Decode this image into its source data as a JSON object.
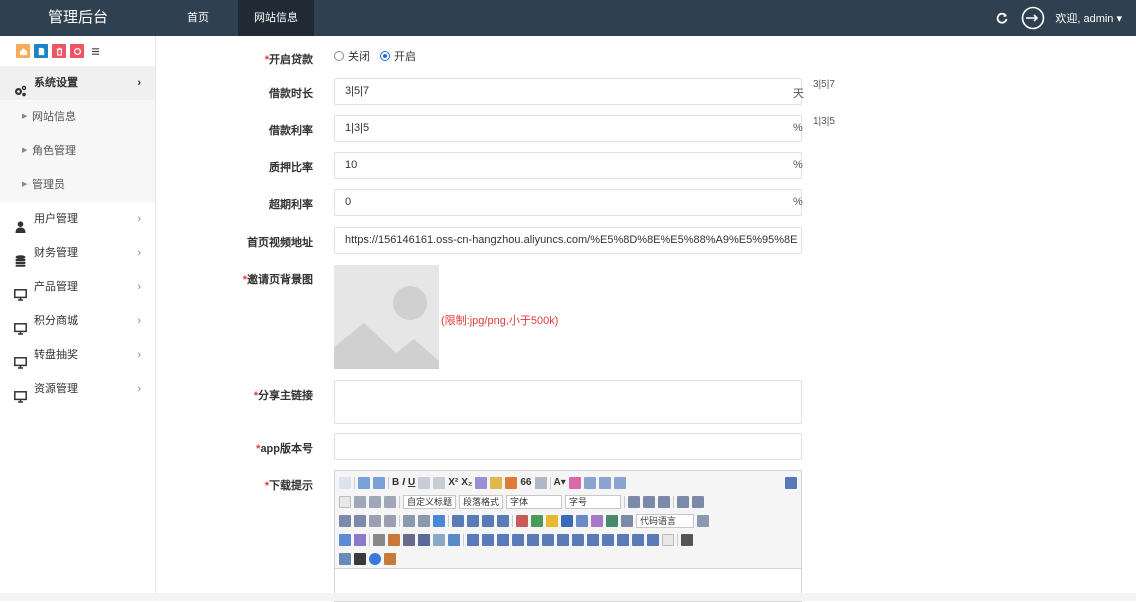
{
  "header": {
    "brand": "管理后台",
    "tabs": [
      {
        "label": "首页"
      },
      {
        "label": "网站信息"
      }
    ],
    "welcome": "欢迎, admin ▾"
  },
  "colors": {
    "topbar": "#2f4050",
    "active_tab": "#1f2a35",
    "required": "#e4393c",
    "shortcut_orange": "#f8ac59",
    "shortcut_blue": "#1c84c6",
    "shortcut_red": "#ed5565"
  },
  "sidebar": {
    "shortcuts": [
      "home-icon",
      "file-icon",
      "trash-icon",
      "recycle-icon",
      "list-icon"
    ],
    "items": [
      {
        "label": "系统设置",
        "icon": "gears-icon",
        "chevron": "›"
      },
      {
        "label": "网站信息",
        "sub": true
      },
      {
        "label": "角色管理",
        "sub": true
      },
      {
        "label": "管理员",
        "sub": true
      },
      {
        "label": "用户管理",
        "icon": "user-icon",
        "chevron": "›"
      },
      {
        "label": "财务管理",
        "icon": "database-icon",
        "chevron": "›"
      },
      {
        "label": "产品管理",
        "icon": "monitor-icon",
        "chevron": "›"
      },
      {
        "label": "积分商城",
        "icon": "monitor-icon",
        "chevron": "›"
      },
      {
        "label": "转盘抽奖",
        "icon": "monitor-icon",
        "chevron": "›"
      },
      {
        "label": "资源管理",
        "icon": "monitor-icon",
        "chevron": "›"
      }
    ]
  },
  "form": {
    "loan_toggle": {
      "label": "开启贷款",
      "options": [
        "关闭",
        "开启"
      ],
      "selected": "开启"
    },
    "loan_term": {
      "label": "借款时长",
      "value": "3|5|7",
      "unit": "天",
      "hint": "3|5|7"
    },
    "loan_rate": {
      "label": "借款利率",
      "value": "1|3|5",
      "unit": "%",
      "hint": "1|3|5"
    },
    "pledge_rate": {
      "label": "质押比率",
      "value": "10",
      "unit": "%"
    },
    "overdue_rate": {
      "label": "超期利率",
      "value": "0",
      "unit": "%"
    },
    "video_url": {
      "label": "首页视频地址",
      "value": "https://156146161.oss-cn-hangzhou.aliyuncs.com/%E5%8D%8E%E5%88%A9%E5%95%8E"
    },
    "invite_bg": {
      "label": "邀请页背景图",
      "limit": "(限制:jpg/png,小于500k)"
    },
    "share_link": {
      "label": "分享主链接",
      "value": ""
    },
    "app_version": {
      "label": "app版本号",
      "value": ""
    },
    "download_tip": {
      "label": "下载提示"
    }
  },
  "editor": {
    "selects": [
      "自定义标题",
      "段落格式",
      "字体",
      "字号",
      "代码语言"
    ]
  }
}
